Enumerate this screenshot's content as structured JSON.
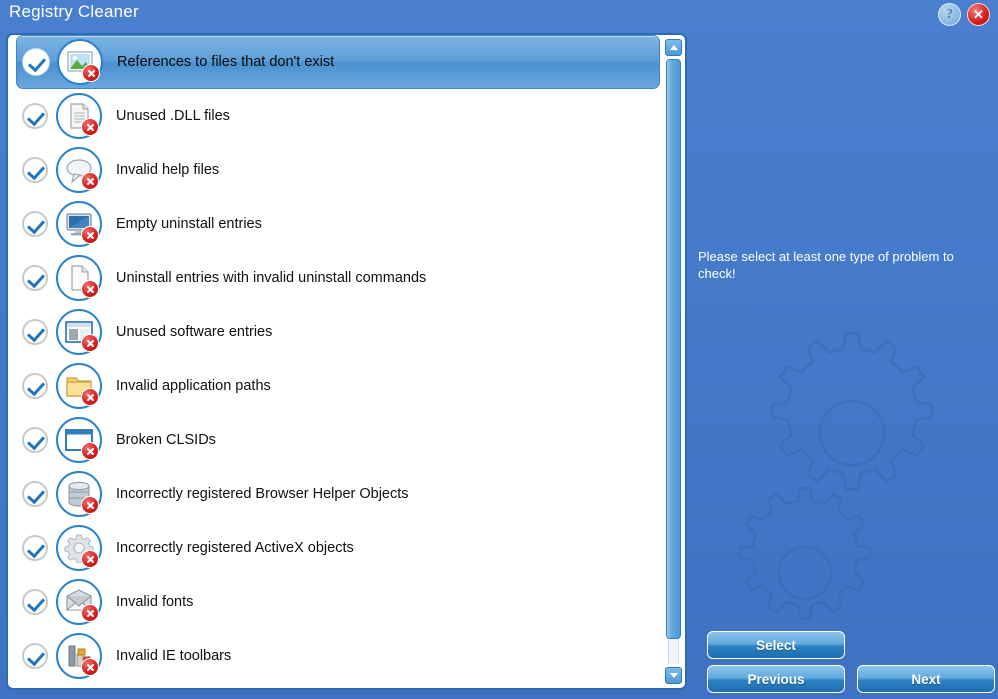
{
  "window": {
    "title": "Registry Cleaner",
    "help_label": "?",
    "close_label": "✕"
  },
  "list": {
    "items": [
      {
        "label": "References to files that don't exist",
        "icon": "picture-icon",
        "checked": true,
        "selected": true
      },
      {
        "label": "Unused .DLL files",
        "icon": "document-icon",
        "checked": true,
        "selected": false
      },
      {
        "label": "Invalid help files",
        "icon": "help-balloon-icon",
        "checked": true,
        "selected": false
      },
      {
        "label": "Empty uninstall entries",
        "icon": "monitor-icon",
        "checked": true,
        "selected": false
      },
      {
        "label": "Uninstall entries with invalid uninstall commands",
        "icon": "page-icon",
        "checked": true,
        "selected": false
      },
      {
        "label": "Unused software entries",
        "icon": "window-app-icon",
        "checked": true,
        "selected": false
      },
      {
        "label": "Invalid application paths",
        "icon": "folder-icon",
        "checked": true,
        "selected": false
      },
      {
        "label": "Broken CLSIDs",
        "icon": "blank-window-icon",
        "checked": true,
        "selected": false
      },
      {
        "label": "Incorrectly registered Browser Helper Objects",
        "icon": "database-icon",
        "checked": true,
        "selected": false
      },
      {
        "label": "Incorrectly registered ActiveX objects",
        "icon": "gear-icon",
        "checked": true,
        "selected": false
      },
      {
        "label": "Invalid fonts",
        "icon": "envelope-icon",
        "checked": true,
        "selected": false
      },
      {
        "label": "Invalid IE toolbars",
        "icon": "toolbar-chart-icon",
        "checked": true,
        "selected": false
      }
    ]
  },
  "scrollbar": {
    "up_arrow": "scroll-up",
    "down_arrow": "scroll-down"
  },
  "right": {
    "hint": "Please select at least one type of problem to check!",
    "buttons": {
      "select": "Select",
      "previous": "Previous",
      "next": "Next"
    }
  },
  "colors": {
    "window_bg": "#3f74c4",
    "title_text": "#ffffff",
    "accent_blue": "#2a82c8",
    "badge_red": "#d62222",
    "selected_row": "#5d9ed8"
  }
}
